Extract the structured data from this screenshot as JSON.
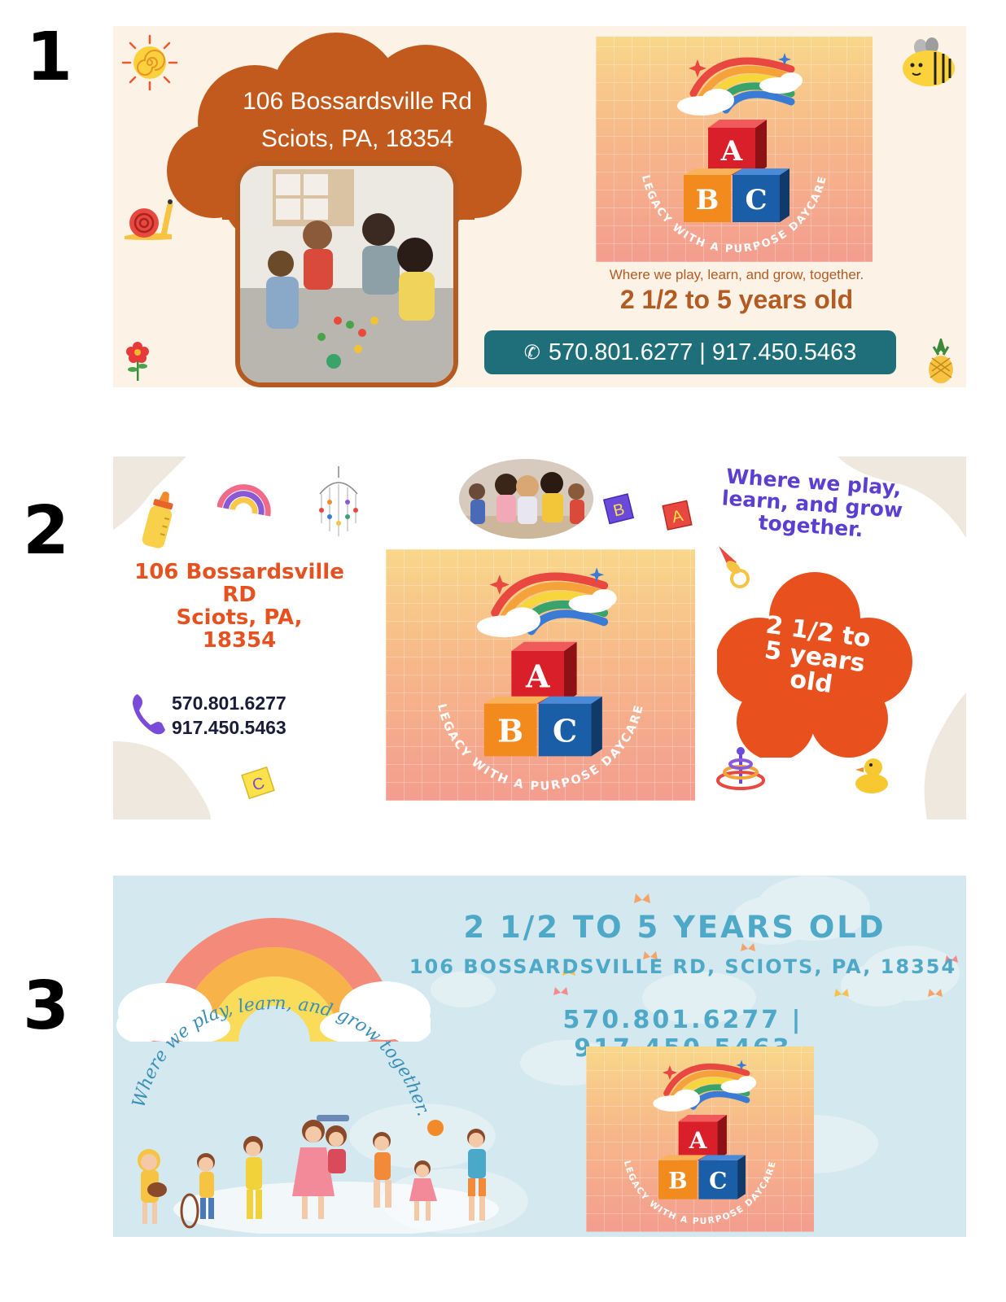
{
  "panels": [
    {
      "number": "1"
    },
    {
      "number": "2"
    },
    {
      "number": "3"
    }
  ],
  "logo": {
    "blocks": [
      "A",
      "B",
      "C"
    ],
    "arc_text": "LEGACY WITH A PURPOSE DAYCARE"
  },
  "banner1": {
    "address_line1": "106 Bossardsville Rd",
    "address_line2": "Sciots, PA, 18354",
    "tagline": "Where we play, learn, and grow, together.",
    "age": "2 1/2 to 5 years old",
    "phone": "570.801.6277 | 917.450.5463",
    "phone_icon": "phone-icon"
  },
  "banner2": {
    "address_line1": "106 Bossardsville",
    "address_line2": "RD",
    "address_line3": "Sciots, PA,",
    "address_line4": "18354",
    "phone1": "570.801.6277",
    "phone2": "917.450.5463",
    "tagline_line1": "Where we play,",
    "tagline_line2": "learn, and grow",
    "tagline_line3": "together.",
    "age_line1": "2 1/2 to",
    "age_line2": "5 years",
    "age_line3": "old",
    "block_a": "A",
    "block_b": "B",
    "block_c": "C"
  },
  "banner3": {
    "age": "2 1/2 TO 5 YEARS OLD",
    "address": "106 BOSSARDSVILLE RD, SCIOTS, PA, 18354",
    "phone": "570.801.6277 | 917.450.5463",
    "arc_tagline": "Where we play, learn, and grow together."
  },
  "colors": {
    "banner1_bg": "#fdf2e6",
    "banner1_accent": "#b55b22",
    "banner1_phone_bg": "#1e6f7a",
    "banner2_orange": "#e5511f",
    "banner2_purple": "#5a3fd1",
    "banner3_bg": "#d3e8ef",
    "banner3_text": "#4ea8c7"
  }
}
